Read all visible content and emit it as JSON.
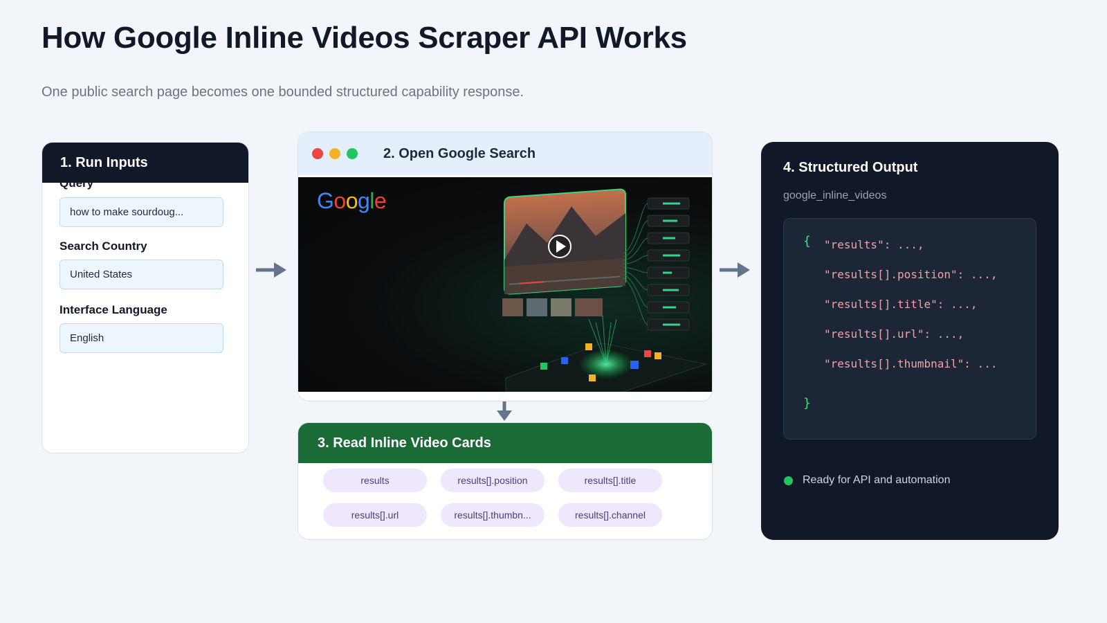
{
  "header": {
    "title": "How Google Inline Videos Scraper API Works",
    "subtitle": "One public search page becomes one bounded structured capability response."
  },
  "inputs_card": {
    "title": "1. Run Inputs",
    "fields": [
      {
        "label": "Query",
        "value": "how to make sourdoug..."
      },
      {
        "label": "Search Country",
        "value": "United States"
      },
      {
        "label": "Interface Language",
        "value": "English"
      }
    ]
  },
  "search_card": {
    "title": "2. Open Google Search",
    "window_dots": [
      "#ef4444",
      "#f5b324",
      "#22c55e"
    ],
    "logo_text": "Google",
    "logo_colors": [
      "#4285f4",
      "#ea4335",
      "#fbbc05",
      "#4285f4",
      "#34a853",
      "#ea4335"
    ]
  },
  "cards_card": {
    "title": "3. Read Inline Video Cards",
    "chips": [
      "results",
      "results[].position",
      "results[].title",
      "results[].url",
      "results[].thumbn...",
      "results[].channel"
    ]
  },
  "output_card": {
    "title": "4. Structured Output",
    "subtitle": "google_inline_videos",
    "open_brace": "{",
    "close_brace": "}",
    "code_lines": [
      "\"results\": ...,",
      "\"results[].position\": ...,",
      "\"results[].title\": ...,",
      "\"results[].url\": ...,",
      "\"results[].thumbnail\": ..."
    ],
    "status": "Ready for API and automation"
  },
  "colors": {
    "dark_header": "#111827",
    "green_header": "#1b6b36",
    "accent_green": "#22c55e",
    "arrow": "#64748b"
  }
}
